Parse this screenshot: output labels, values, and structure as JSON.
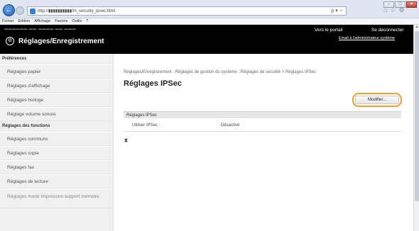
{
  "browser": {
    "url": "http://▮▮▮▮▮▮▮▮▮▮/m_security_ipsec.html",
    "url_tools": "ρ ▾ ♂",
    "menu": [
      "Fichier",
      "Edition",
      "Affichage",
      "Favoris",
      "Outils",
      "?"
    ]
  },
  "header": {
    "title": "Réglages/Enregistrement",
    "portal_link": "Vers le portail",
    "logout_link": "Se déconnecter",
    "admin_link": "Email à l'administrateur système"
  },
  "sidebar": {
    "sections": [
      {
        "title": "Préférences",
        "items": [
          "Réglages papier",
          "Réglages d'affichage",
          "Réglages horloge",
          "Réglage volume sonore"
        ]
      },
      {
        "title": "Réglages des fonctions",
        "items": [
          "Réglages communs",
          "Réglages copie",
          "Réglages fax",
          "Réglages de lecture",
          "Réglages mode Impression support mémoire"
        ]
      }
    ]
  },
  "main": {
    "breadcrumb": "Réglages/Enregistrement : Réglages de gestion du système : Réglages de sécurité > Réglages IPSec",
    "title": "Réglages IPSec",
    "modify_button": "Modifier...",
    "section_title": "Réglages IPSec",
    "rows": [
      {
        "label": "Utiliser IPSec :",
        "value": "Désactivé"
      }
    ],
    "top_icon": "⧗"
  },
  "colors": {
    "header_bg": "#000000",
    "highlight": "#f0a030",
    "sidebar_bg": "#f0f0f0"
  }
}
